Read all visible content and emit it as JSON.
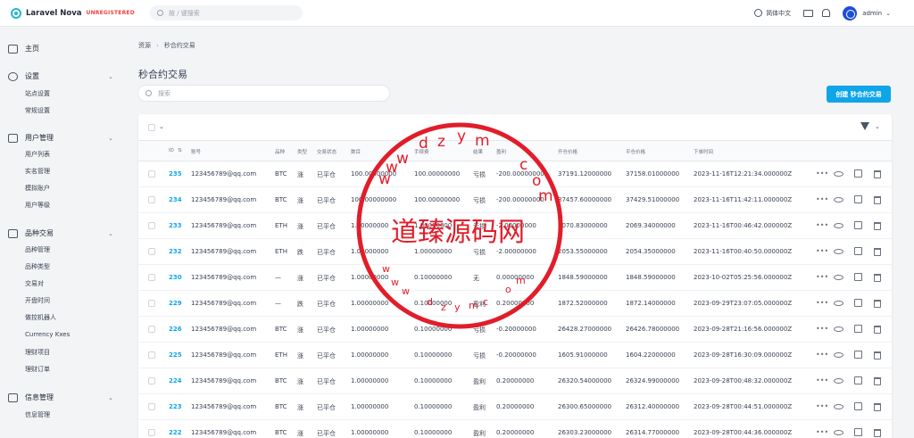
{
  "app": {
    "name": "Laravel Nova",
    "tag": "UNREGISTERED"
  },
  "header": {
    "search_placeholder": "按 / 键搜索",
    "language": "简体中文",
    "user": "admin"
  },
  "sidebar": {
    "home": "主页",
    "groups": [
      {
        "label": "设置",
        "icon": "gear-icon",
        "items": [
          "站点设置",
          "常规设置"
        ]
      },
      {
        "label": "用户管理",
        "icon": "users-icon",
        "items": [
          "用户列表",
          "实名管理",
          "模拟账户",
          "用户等级"
        ]
      },
      {
        "label": "品种交易",
        "icon": "sliders-icon",
        "items": [
          "品种管理",
          "品种类型",
          "交易对",
          "开盘时间",
          "做控机器人",
          "Currency Kxes",
          "理财项目",
          "理财订单"
        ]
      },
      {
        "label": "信息管理",
        "icon": "message-icon",
        "items": [
          "信息管理"
        ]
      }
    ]
  },
  "breadcrumb": {
    "root": "资源",
    "current": "秒合约交易"
  },
  "page": {
    "title": "秒合约交易",
    "search_placeholder": "搜索",
    "create_label": "创建 秒合约交易"
  },
  "table": {
    "headers": [
      "ID",
      "账号",
      "品种",
      "类型",
      "交易状态",
      "数目",
      "手续费",
      "结果",
      "盈利",
      "开仓价格",
      "平仓价格",
      "下单时间"
    ],
    "rows": [
      [
        "235",
        "123456789@qq.com",
        "BTC",
        "涨",
        "已平仓",
        "100.00000000",
        "100.00000000",
        "亏损",
        "-200.00000000",
        "37191.12000000",
        "37158.01000000",
        "2023-11-16T12:21:34.000000Z"
      ],
      [
        "234",
        "123456789@qq.com",
        "BTC",
        "涨",
        "已平仓",
        "100.00000000",
        "100.00000000",
        "亏损",
        "-200.00000000",
        "37457.60000000",
        "37429.51000000",
        "2023-11-16T11:42:11.000000Z"
      ],
      [
        "233",
        "123456789@qq.com",
        "ETH",
        "涨",
        "已平仓",
        "1.00000000",
        "1.00000000",
        "亏损",
        "-2.00000000",
        "2070.83000000",
        "2069.34000000",
        "2023-11-16T00:46:42.000000Z"
      ],
      [
        "232",
        "123456789@qq.com",
        "ETH",
        "跌",
        "已平仓",
        "1.00000000",
        "1.00000000",
        "亏损",
        "-2.00000000",
        "2053.55000000",
        "2054.35000000",
        "2023-11-16T00:40:50.000000Z"
      ],
      [
        "230",
        "123456789@qq.com",
        "—",
        "涨",
        "已平仓",
        "1.00000000",
        "0.10000000",
        "无",
        "0.00000000",
        "1848.59000000",
        "1848.59000000",
        "2023-10-02T05:25:56.000000Z"
      ],
      [
        "229",
        "123456789@qq.com",
        "—",
        "跌",
        "已平仓",
        "1.00000000",
        "0.10000000",
        "盈利",
        "0.20000000",
        "1872.52000000",
        "1872.14000000",
        "2023-09-29T23:07:05.000000Z"
      ],
      [
        "226",
        "123456789@qq.com",
        "BTC",
        "涨",
        "已平仓",
        "1.00000000",
        "0.10000000",
        "亏损",
        "-0.20000000",
        "26428.27000000",
        "26426.78000000",
        "2023-09-28T21:16:56.000000Z"
      ],
      [
        "225",
        "123456789@qq.com",
        "ETH",
        "涨",
        "已平仓",
        "1.00000000",
        "0.10000000",
        "亏损",
        "-0.20000000",
        "1605.91000000",
        "1604.22000000",
        "2023-09-28T16:30:09.000000Z"
      ],
      [
        "224",
        "123456789@qq.com",
        "BTC",
        "涨",
        "已平仓",
        "1.00000000",
        "0.10000000",
        "盈利",
        "0.20000000",
        "26320.54000000",
        "26324.99000000",
        "2023-09-28T00:48:32.000000Z"
      ],
      [
        "223",
        "123456789@qq.com",
        "BTC",
        "涨",
        "已平仓",
        "1.00000000",
        "0.10000000",
        "盈利",
        "0.20000000",
        "26300.65000000",
        "26312.40000000",
        "2023-09-28T00:44:51.000000Z"
      ],
      [
        "222",
        "123456789@qq.com",
        "BTC",
        "涨",
        "已平仓",
        "1.00000000",
        "0.10000000",
        "盈利",
        "0.20000000",
        "26303.23000000",
        "26314.77000000",
        "2023-09-28T00:44:36.000000Z"
      ]
    ],
    "row_actions": {
      "more": "•••"
    }
  },
  "watermark": {
    "text": "道臻源码网",
    "letters_top": [
      "w",
      "w",
      "w",
      "d",
      "z",
      "y",
      "m",
      "c",
      "o",
      "m"
    ],
    "letters_bottom": [
      "w",
      "w",
      "w",
      "d",
      "z",
      "y",
      "m",
      "c",
      "o",
      "m"
    ],
    "color": "#e11d2a"
  },
  "colors": {
    "accent": "#0ea5e9",
    "watermark": "#e11d2a"
  }
}
